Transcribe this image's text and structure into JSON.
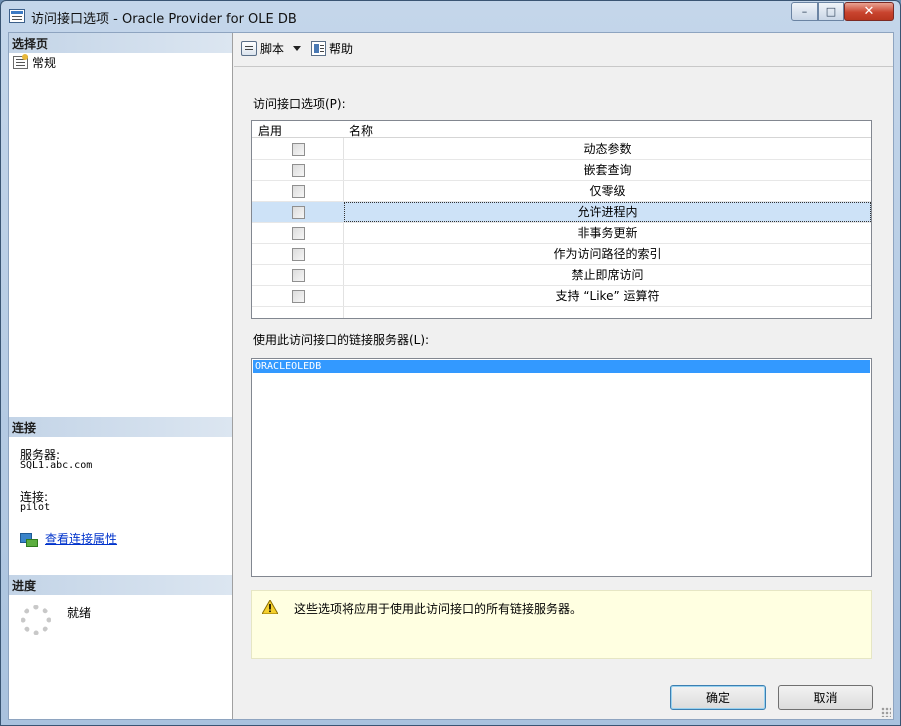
{
  "window": {
    "title": "访问接口选项 - Oracle Provider for OLE DB",
    "controls": {
      "minimize": "–",
      "maximize": "□",
      "close": "✕"
    }
  },
  "left_pane": {
    "select_page_header": "选择页",
    "pages": [
      {
        "label": "常规",
        "icon": "page-settings-icon"
      }
    ],
    "connection_header": "连接",
    "server_label": "服务器:",
    "server_value": "SQL1.abc.com",
    "connection_label": "连接:",
    "connection_value": "pilot",
    "view_connection_link": "查看连接属性",
    "progress_header": "进度",
    "progress_status": "就绪"
  },
  "toolbar": {
    "script_label": "脚本",
    "help_label": "帮助"
  },
  "options": {
    "label": "访问接口选项(P):",
    "columns": {
      "enabled": "启用",
      "name": "名称"
    },
    "rows": [
      {
        "name": "动态参数",
        "checked": false
      },
      {
        "name": "嵌套查询",
        "checked": false
      },
      {
        "name": "仅零级",
        "checked": false
      },
      {
        "name": "允许进程内",
        "checked": false,
        "selected": true
      },
      {
        "name": "非事务更新",
        "checked": false
      },
      {
        "name": "作为访问路径的索引",
        "checked": false
      },
      {
        "name": "禁止即席访问",
        "checked": false
      },
      {
        "name": "支持 “Like” 运算符",
        "checked": false
      }
    ]
  },
  "linked_servers": {
    "label": "使用此访问接口的链接服务器(L):",
    "items": [
      "ORACLEOLEDB"
    ]
  },
  "info": {
    "icon": "warning-icon",
    "text": "这些选项将应用于使用此访问接口的所有链接服务器。"
  },
  "buttons": {
    "ok": "确定",
    "cancel": "取消"
  },
  "colors": {
    "selection": "#3399ff",
    "selected_row": "#cde2f7",
    "info_background": "#ffffe1",
    "link": "#0033cc"
  }
}
